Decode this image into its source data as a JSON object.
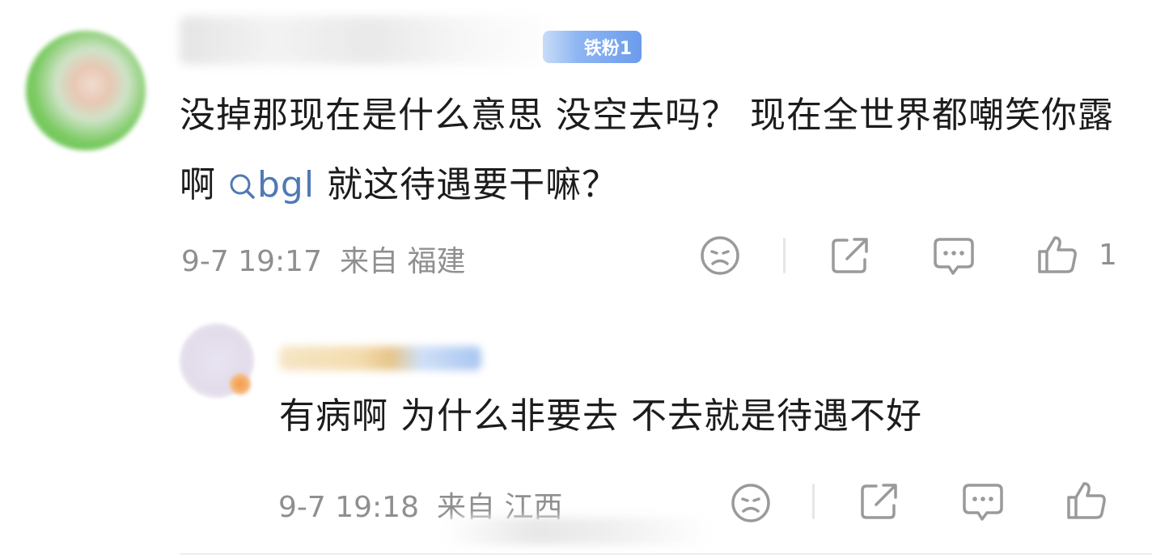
{
  "comments": [
    {
      "badge": "铁粉1",
      "text_before": "没掉那现在是什么意思 没空去吗？ 现在全世界都嘲笑你露啊 ",
      "search_term": "bgl",
      "text_after": " 就这待遇要干嘛？",
      "date": "9-7 19:17",
      "source": "来自 福建",
      "like_count": "1",
      "icons": [
        "sad-face-icon",
        "share-icon",
        "comment-icon",
        "thumbs-up-icon"
      ]
    },
    {
      "text": "有病啊 为什么非要去 不去就是待遇不好",
      "date": "9-7 19:18",
      "source": "来自 江西",
      "icons": [
        "sad-face-icon",
        "share-icon",
        "comment-icon",
        "thumbs-up-icon"
      ]
    }
  ],
  "colors": {
    "text": "#1c1c1c",
    "meta": "#8f8f8f",
    "link": "#4f79b4",
    "badge": "#6b9cec",
    "icon": "#9a9a9a"
  }
}
